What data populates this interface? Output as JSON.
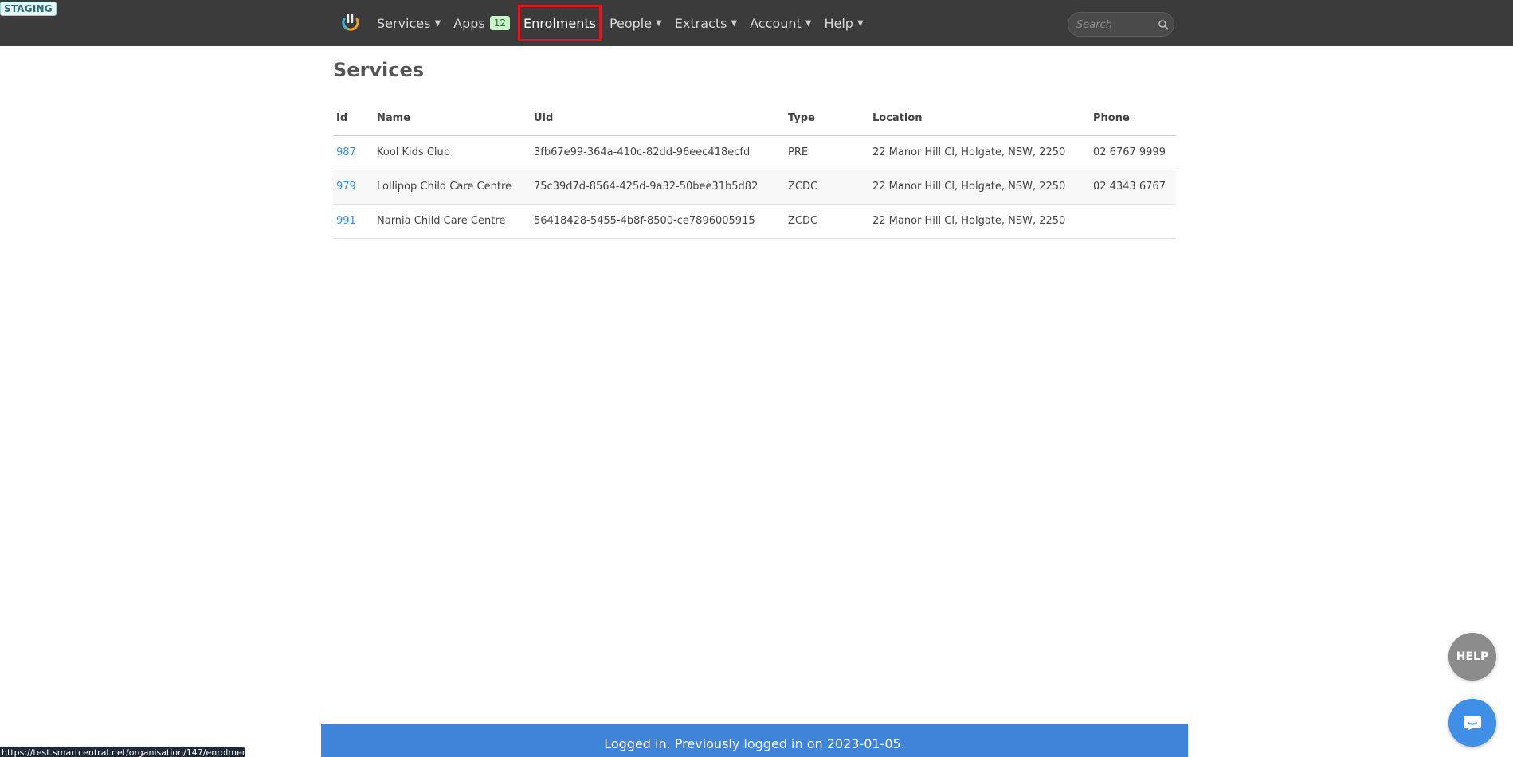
{
  "env_badge": "STAGING",
  "nav": {
    "items": [
      {
        "label": "Services",
        "dropdown": true
      },
      {
        "label": "Apps",
        "badge": "12",
        "dropdown": false
      },
      {
        "label": "Enrolments",
        "dropdown": false,
        "active": true
      },
      {
        "label": "People",
        "dropdown": true
      },
      {
        "label": "Extracts",
        "dropdown": true
      },
      {
        "label": "Account",
        "dropdown": true
      },
      {
        "label": "Help",
        "dropdown": true
      }
    ],
    "caret": "▼",
    "search_placeholder": "Search"
  },
  "page": {
    "title": "Services",
    "table": {
      "headers": [
        "Id",
        "Name",
        "Uid",
        "Type",
        "Location",
        "Phone"
      ],
      "rows": [
        {
          "id": "987",
          "name": "Kool Kids Club",
          "uid": "3fb67e99-364a-410c-82dd-96eec418ecfd",
          "type": "PRE",
          "location": "22 Manor Hill Cl, Holgate, NSW, 2250",
          "phone": "02 6767 9999"
        },
        {
          "id": "979",
          "name": "Lollipop Child Care Centre",
          "uid": "75c39d7d-8564-425d-9a32-50bee31b5d82",
          "type": "ZCDC",
          "location": "22 Manor Hill Cl, Holgate, NSW, 2250",
          "phone": "02 4343 6767"
        },
        {
          "id": "991",
          "name": "Narnia Child Care Centre",
          "uid": "56418428-5455-4b8f-8500-ce7896005915",
          "type": "ZCDC",
          "location": "22 Manor Hill Cl, Holgate, NSW, 2250",
          "phone": ""
        }
      ]
    }
  },
  "footer": {
    "message": "Logged in. Previously logged in on 2023-01-05."
  },
  "status_bar_url": "https://test.smartcentral.net/organisation/147/enrolment",
  "help_button_label": "HELP",
  "icons": {
    "logo": "smartcentral-logo-icon",
    "search": "search-icon",
    "chat": "chat-bubble-icon"
  },
  "colors": {
    "navbar": "#3b3b3b",
    "active_outline": "#e0161e",
    "link": "#3a8ed6",
    "footer": "#3f84d9",
    "badge_bg": "#c9f3c9"
  }
}
